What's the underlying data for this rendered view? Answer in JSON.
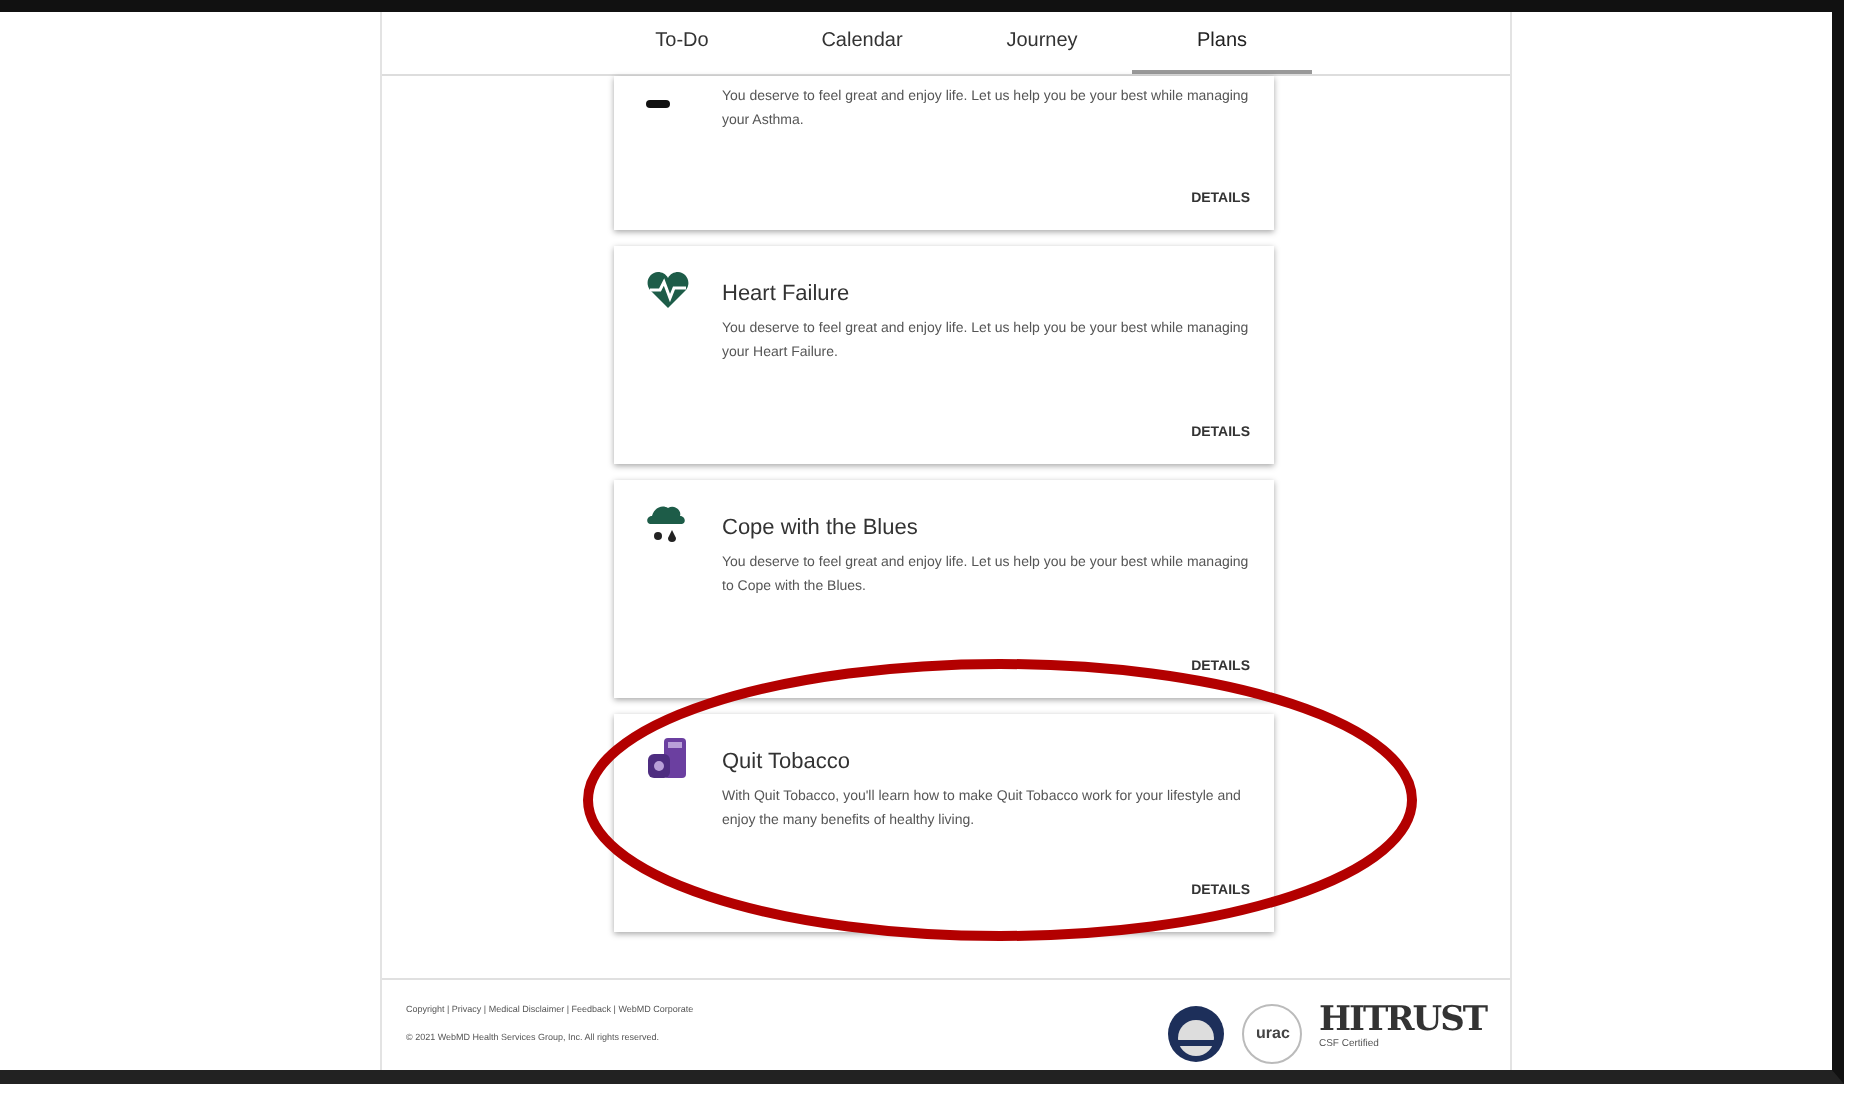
{
  "tabs": [
    {
      "label": "To-Do",
      "selected": false
    },
    {
      "label": "Calendar",
      "selected": false
    },
    {
      "label": "Journey",
      "selected": false
    },
    {
      "label": "Plans",
      "selected": true
    }
  ],
  "plans": [
    {
      "kind": "bar",
      "description": "You deserve to feel great and enjoy life. Let us help you be your best while managing your Asthma.",
      "button": "DETAILS"
    },
    {
      "kind": "heart",
      "title": "Heart Failure",
      "description": "You deserve to feel great and enjoy life. Let us help you be your best while managing your Heart Failure.",
      "button": "DETAILS"
    },
    {
      "kind": "cloud",
      "title": "Cope with the Blues",
      "description": "You deserve to feel great and enjoy life. Let us help you be your best while managing to Cope with the Blues.",
      "button": "DETAILS"
    },
    {
      "kind": "canisters",
      "title": "Quit Tobacco",
      "description": "With Quit Tobacco, you'll learn how to make Quit Tobacco work for your lifestyle and enjoy the many benefits of healthy living.",
      "button": "DETAILS"
    }
  ],
  "footer": {
    "links": "Copyright | Privacy | Medical Disclaimer | Feedback | WebMD Corporate",
    "copyright": "© 2021 WebMD Health Services Group, Inc. All rights reserved.",
    "badges": [
      {
        "kind": "seal"
      },
      {
        "kind": "circle",
        "text": "urac"
      },
      {
        "kind": "wordmark",
        "text": "HITRUST",
        "subtext": "CSF Certified"
      }
    ]
  },
  "highlight_ellipse": true
}
